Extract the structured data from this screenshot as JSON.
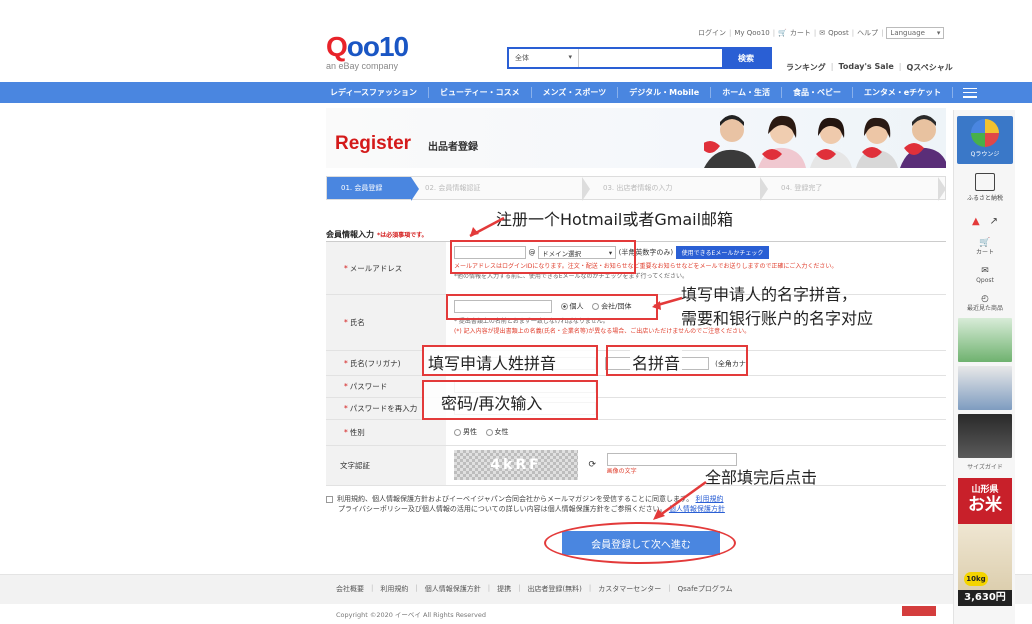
{
  "header": {
    "logo_text_red": "Q",
    "logo_text_blue": "oo10",
    "logo_sub": "an eBay company",
    "top_links": [
      "ログイン",
      "My Qoo10",
      "カート",
      "Qpost",
      "ヘルプ"
    ],
    "language_label": "Language",
    "search_category": "全体",
    "search_button": "検索",
    "sub_links": [
      "ランキング",
      "Today's Sale",
      "Qスペシャル"
    ]
  },
  "nav": {
    "items": [
      "レディースファッション",
      "ビューティー・コスメ",
      "メンズ・スポーツ",
      "デジタル・Mobile",
      "ホーム・生活",
      "食品・ベビー",
      "エンタメ・eチケット"
    ]
  },
  "banner": {
    "title": "Register",
    "subtitle": "出品者登録"
  },
  "steps": [
    "01. 会員登録",
    "02. 会員情報認証",
    "03. 出店者情報の入力",
    "04. 登録完了"
  ],
  "form": {
    "section_title": "会員情報入力",
    "required_note": "は必須事項です。",
    "rows": {
      "email": {
        "label": "メールアドレス",
        "at": "@",
        "domain_select": "ドメイン選択",
        "hint": "(半角英数字のみ)",
        "check_button": "使用できるEメールかチェック",
        "note_red": "メールアドレスはログインIDになります。注文・配送・お知らせなど重要なお知らせなどをメールでお送りしますので正確にご入力ください。",
        "note": "*他の情報を入力する前に、使用できるEメールなのかチェックをまず行ってください。"
      },
      "name": {
        "label": "氏名",
        "radio_individual": "個人",
        "radio_company": "会社/団体",
        "note": "* 提出書類上の名前とおまず一致しなければなりません。",
        "note_red": "(*) 記入内容が提出書類上の名義(氏名・企業名等)が異なる場合、ご出店いただけませんのでご注意ください。"
      },
      "furigana": {
        "label": "氏名(フリガナ)",
        "hint": "(全角カナ)"
      },
      "password": {
        "label": "パスワード"
      },
      "password_confirm": {
        "label": "パスワードを再入力"
      },
      "gender": {
        "label": "性別",
        "male": "男性",
        "female": "女性"
      },
      "captcha": {
        "label": "文字認証",
        "image_text": "4kRF",
        "hint": "画像の文字"
      }
    },
    "agreement_line1": "利用規約、個人情報保護方針およびイーベイジャパン合同会社からメールマガジンを受信することに同意します。",
    "agreement_link1": "利用規約",
    "agreement_line2": "プライバシーポリシー及び個人情報の活用についての詳しい内容は個人情報保護方針をご参照ください。",
    "agreement_link2": "個人情報保護方針",
    "submit": "会員登録して次へ進む"
  },
  "footer": {
    "links": [
      "会社概要",
      "利用規約",
      "個人情報保護方針",
      "提携",
      "出店者登録(無料)",
      "カスタマーセンター",
      "Qsafeプログラム"
    ],
    "copyright": "Copyright ©2020 イーベイ All Rights Reserved"
  },
  "sidebar": {
    "qlounge": "Qラウンジ",
    "furusato": "ふるさと納税",
    "cart": "カート",
    "qpost": "Qpost",
    "recent": "最近見た商品",
    "size_guide": "サイズガイド",
    "yamagata_1": "山形県",
    "yamagata_2": "お米",
    "rice_weight": "10kg",
    "rice_price": "3,630円"
  },
  "annotations": {
    "email_tip": "注册一个Hotmail或者Gmail邮箱",
    "name_tip_1": "填写申请人的名字拼音，",
    "name_tip_2": "需要和银行账户的名字对应",
    "surname_tip": "填写申请人姓拼音",
    "given_tip": "名拼音",
    "password_tip": "密码/再次输入",
    "submit_tip": "全部填完后点击"
  },
  "colors": {
    "brand_red": "#e8232a",
    "brand_blue": "#2a5fd4",
    "nav_blue": "#4a86e0",
    "annotation_red": "#e33a3a"
  }
}
